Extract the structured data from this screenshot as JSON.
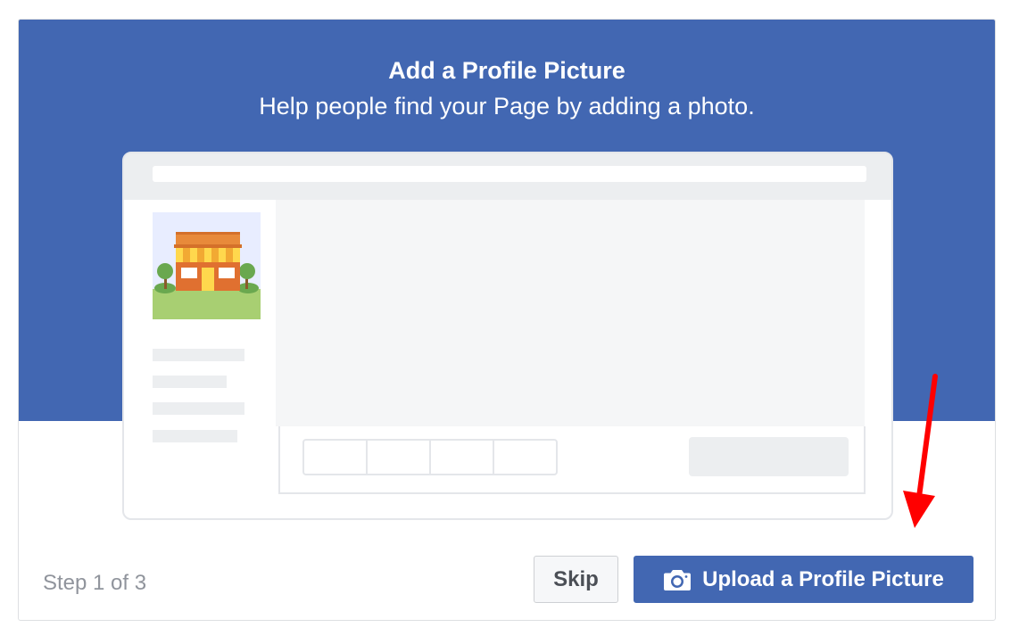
{
  "dialog": {
    "title": "Add a Profile Picture",
    "subtitle": "Help people find your Page by adding a photo."
  },
  "footer": {
    "step_text": "Step 1 of 3",
    "skip_label": "Skip",
    "upload_label": "Upload a Profile Picture"
  },
  "icons": {
    "upload_icon": "camera-icon",
    "illustration": "storefront-illustration",
    "annotation": "red-arrow"
  },
  "colors": {
    "brand_blue": "#4267b2",
    "arrow_red": "#ff0000",
    "muted_text": "#90949c"
  }
}
